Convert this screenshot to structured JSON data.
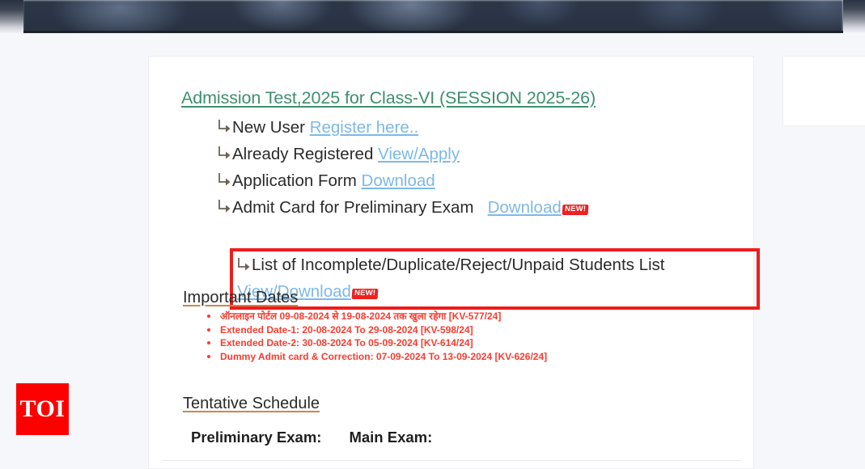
{
  "page": {
    "background_color": "#f6f7fb",
    "banner_label": "students-exam-photo-banner"
  },
  "notice": {
    "title": "Admission Test,2025 for Class-VI (SESSION 2025-26)",
    "title_color": "#3d8f6f",
    "link_color": "#7cb9e8",
    "arrow_icon": "right-turn-arrow-icon",
    "rows": [
      {
        "text": "New User",
        "link": "Register here..",
        "badge": ""
      },
      {
        "text": "Already Registered",
        "link": "View/Apply",
        "badge": ""
      },
      {
        "text": "Application Form",
        "link": "Download",
        "badge": ""
      },
      {
        "text": "Admit Card for Preliminary Exam",
        "link": "Download",
        "badge": "NEW!"
      }
    ],
    "highlight": {
      "border_color": "#ee1c1c",
      "line1": "List of Incomplete/Duplicate/Reject/Unpaid Students List",
      "link": "View/Download",
      "badge": "NEW!"
    }
  },
  "important_dates": {
    "heading": "Important Dates",
    "text_color": "#fb3b2e",
    "items": [
      "ऑनलाइन पोर्टल 09-08-2024 से 19-08-2024 तक खुला रहेगा [KV-577/24]",
      "Extended Date-1: 20-08-2024 To 29-08-2024 [KV-598/24]",
      "Extended Date-2: 30-08-2024 To 05-09-2024 [KV-614/24]",
      "Dummy Admit card & Correction: 07-09-2024 To 13-09-2024 [KV-626/24]"
    ]
  },
  "tentative_schedule": {
    "heading": "Tentative Schedule",
    "preliminary_label": "Preliminary Exam:",
    "main_label": "Main Exam:"
  },
  "watermark": {
    "text": "TOI",
    "background_color": "#fd0000"
  }
}
